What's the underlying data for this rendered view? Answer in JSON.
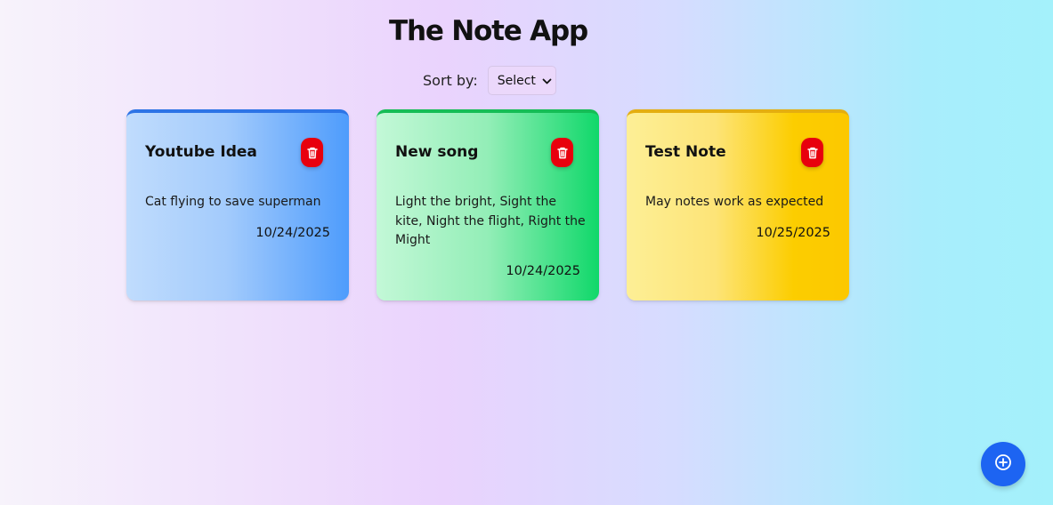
{
  "header": {
    "title": "The Note App"
  },
  "sort": {
    "label": "Sort by:",
    "selected": "Select"
  },
  "notes": [
    {
      "title": "Youtube Idea",
      "body": "Cat flying to save superman",
      "date": "10/24/2025",
      "color": "blue",
      "accent": "#2d74e6"
    },
    {
      "title": "New song",
      "body": "Light the bright, Sight the kite, Night the flight, Right the Might",
      "date": "10/24/2025",
      "color": "green",
      "accent": "#15bd56"
    },
    {
      "title": "Test Note",
      "body": "May notes work as expected",
      "date": "10/25/2025",
      "color": "yellow",
      "accent": "#e4ae10"
    }
  ],
  "icons": {
    "delete": "trash-icon",
    "add": "plus-circle-icon",
    "dropdown": "chevron-down-icon"
  },
  "colors": {
    "delete_button": "#e8000d",
    "add_button": "#1d64f2"
  }
}
